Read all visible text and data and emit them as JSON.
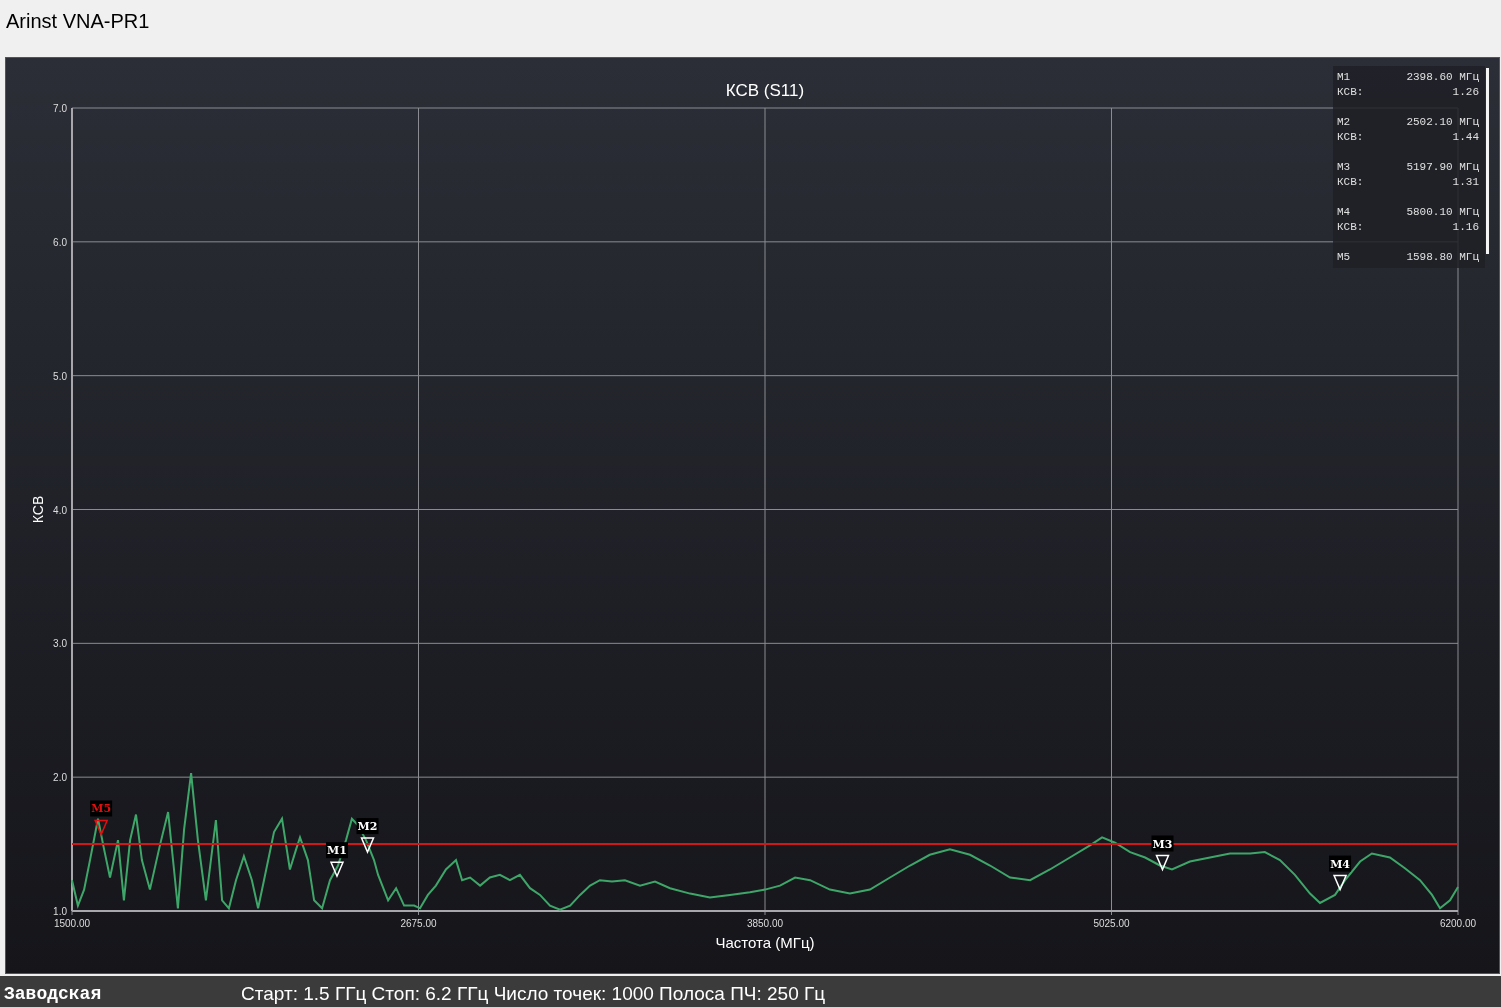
{
  "window": {
    "title": "Arinst VNA-PR1"
  },
  "chart": {
    "chart_data": {
      "type": "line",
      "title": "КСВ (S11)",
      "xlabel": "Частота (МГц)",
      "ylabel": "КСВ",
      "xlim": [
        1500,
        6200
      ],
      "ylim": [
        1,
        7
      ],
      "xticks": [
        {
          "value": 1500,
          "label": "1500.00"
        },
        {
          "value": 2675,
          "label": "2675.00"
        },
        {
          "value": 3850,
          "label": "3850.00"
        },
        {
          "value": 5025,
          "label": "5025.00"
        },
        {
          "value": 6200,
          "label": "6200.00"
        }
      ],
      "yticks": [
        {
          "value": 1,
          "label": "1.0"
        },
        {
          "value": 2,
          "label": "2.0"
        },
        {
          "value": 3,
          "label": "3.0"
        },
        {
          "value": 4,
          "label": "4.0"
        },
        {
          "value": 5,
          "label": "5.0"
        },
        {
          "value": 6,
          "label": "6.0"
        },
        {
          "value": 7,
          "label": "7.0"
        }
      ],
      "x": [
        1500,
        1520,
        1541,
        1561,
        1588,
        1609,
        1629,
        1656,
        1676,
        1697,
        1717,
        1737,
        1764,
        1798,
        1826,
        1846,
        1859,
        1880,
        1904,
        1927,
        1954,
        1988,
        2009,
        2032,
        2056,
        2083,
        2110,
        2131,
        2151,
        2185,
        2212,
        2239,
        2260,
        2273,
        2300,
        2321,
        2348,
        2375,
        2402,
        2429,
        2449,
        2470,
        2497,
        2524,
        2538,
        2572,
        2599,
        2626,
        2660,
        2680,
        2707,
        2734,
        2768,
        2802,
        2823,
        2850,
        2884,
        2917,
        2951,
        2985,
        3019,
        3053,
        3087,
        3121,
        3155,
        3189,
        3223,
        3257,
        3290,
        3331,
        3375,
        3426,
        3477,
        3528,
        3596,
        3663,
        3731,
        3799,
        3850,
        3901,
        3952,
        4003,
        4070,
        4138,
        4206,
        4274,
        4342,
        4409,
        4477,
        4545,
        4613,
        4681,
        4749,
        4816,
        4884,
        4952,
        4993,
        5037,
        5088,
        5139,
        5189,
        5230,
        5291,
        5359,
        5427,
        5495,
        5545,
        5596,
        5647,
        5698,
        5732,
        5783,
        5817,
        5868,
        5908,
        5969,
        6020,
        6071,
        6112,
        6139,
        6173,
        6200
      ],
      "series": [
        {
          "color": "#3fa66a",
          "values": [
            1.23,
            1.04,
            1.16,
            1.38,
            1.69,
            1.46,
            1.25,
            1.53,
            1.08,
            1.53,
            1.72,
            1.38,
            1.16,
            1.49,
            1.74,
            1.31,
            1.02,
            1.61,
            2.03,
            1.53,
            1.08,
            1.68,
            1.08,
            1.02,
            1.23,
            1.41,
            1.23,
            1.02,
            1.23,
            1.59,
            1.69,
            1.31,
            1.46,
            1.55,
            1.38,
            1.08,
            1.02,
            1.23,
            1.34,
            1.53,
            1.69,
            1.64,
            1.53,
            1.38,
            1.27,
            1.08,
            1.17,
            1.04,
            1.04,
            1.02,
            1.12,
            1.19,
            1.31,
            1.38,
            1.23,
            1.25,
            1.19,
            1.25,
            1.27,
            1.23,
            1.27,
            1.17,
            1.12,
            1.04,
            1.01,
            1.04,
            1.12,
            1.19,
            1.23,
            1.22,
            1.23,
            1.19,
            1.22,
            1.17,
            1.13,
            1.1,
            1.12,
            1.14,
            1.16,
            1.19,
            1.25,
            1.23,
            1.16,
            1.13,
            1.16,
            1.25,
            1.34,
            1.42,
            1.46,
            1.42,
            1.34,
            1.25,
            1.23,
            1.31,
            1.4,
            1.49,
            1.55,
            1.51,
            1.44,
            1.4,
            1.34,
            1.31,
            1.37,
            1.4,
            1.43,
            1.43,
            1.44,
            1.38,
            1.27,
            1.13,
            1.06,
            1.12,
            1.23,
            1.37,
            1.43,
            1.4,
            1.32,
            1.23,
            1.12,
            1.02,
            1.08,
            1.18
          ]
        }
      ],
      "grid": true,
      "ref_lines": [
        {
          "axis": "y",
          "value": 1.5,
          "color": "#d01818"
        }
      ]
    },
    "markers": [
      {
        "label": "M1",
        "color": "#ffffff"
      },
      {
        "label": "M2",
        "color": "#ffffff"
      },
      {
        "label": "M3",
        "color": "#ffffff"
      },
      {
        "label": "M4",
        "color": "#ffffff"
      },
      {
        "label": "M5",
        "color": "#e01010"
      }
    ],
    "readout": [
      {
        "name": "M1",
        "frequency": "2398.60 МГц",
        "param": "КСВ:",
        "value": "1.26"
      },
      {
        "name": "M2",
        "frequency": "2502.10 МГц",
        "param": "КСВ:",
        "value": "1.44"
      },
      {
        "name": "M3",
        "frequency": "5197.90 МГц",
        "param": "КСВ:",
        "value": "1.31"
      },
      {
        "name": "M4",
        "frequency": "5800.10 МГц",
        "param": "КСВ:",
        "value": "1.16"
      },
      {
        "name": "M5",
        "frequency": "1598.80 МГц"
      }
    ]
  },
  "status_bar": {
    "profile": "Заводская",
    "settings": "Старт: 1.5 ГГц Стоп: 6.2 ГГц Число точек: 1000 Полоса ПЧ: 250 Гц"
  }
}
